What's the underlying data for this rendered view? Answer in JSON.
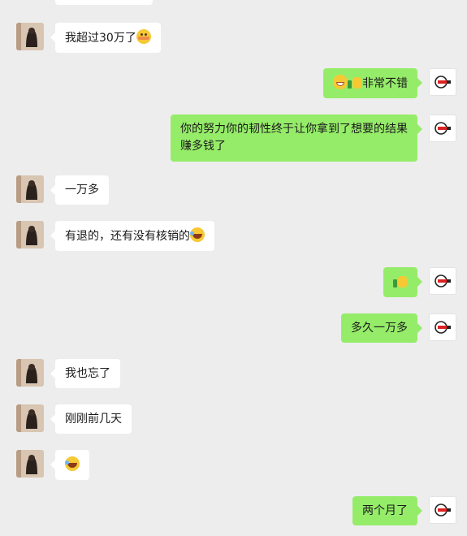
{
  "messages": [
    {
      "side": "left",
      "text": "我超过30万了",
      "emoji": "flushed-face"
    },
    {
      "side": "right",
      "prefix_emoji": [
        "grinning-face",
        "thumbs-up"
      ],
      "text": "非常不错"
    },
    {
      "side": "right",
      "text": "你的努力你的韧性终于让你拿到了想要的结果赚多钱了"
    },
    {
      "side": "left",
      "text": "一万多"
    },
    {
      "side": "left",
      "text": "有退的，还有没有核销的",
      "emoji": "laughing-tears"
    },
    {
      "side": "right",
      "text": "",
      "emoji": "thumbs-up"
    },
    {
      "side": "right",
      "text": "多久一万多"
    },
    {
      "side": "left",
      "text": "我也忘了"
    },
    {
      "side": "left",
      "text": "刚刚前几天"
    },
    {
      "side": "left",
      "text": "",
      "emoji": "laughing-tears"
    },
    {
      "side": "right",
      "text": "两个月了"
    }
  ],
  "colors": {
    "background": "#ededed",
    "sent_bubble": "#95ec69",
    "received_bubble": "#ffffff"
  }
}
